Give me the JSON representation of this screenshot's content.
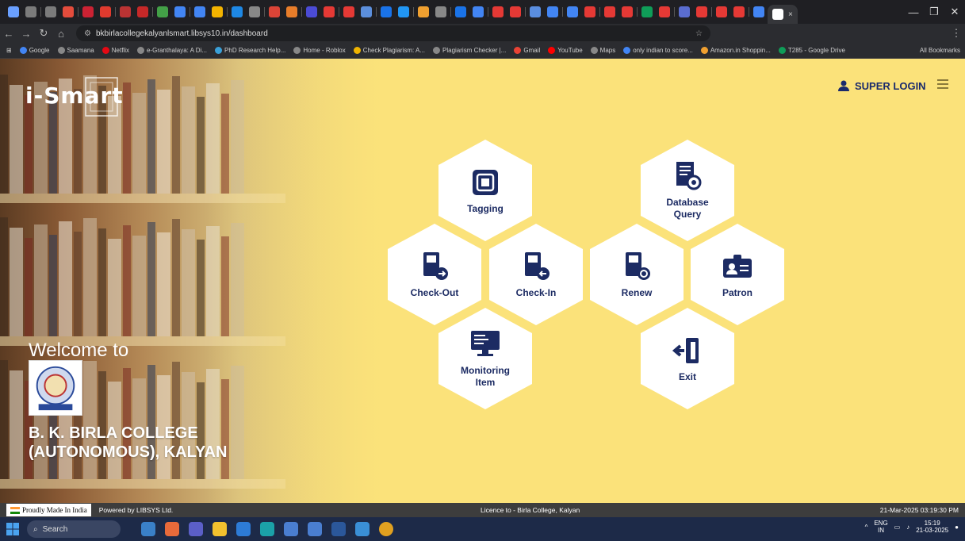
{
  "browser": {
    "url": "bkbirlacollegekalyanlsmart.libsys10.in/dashboard",
    "tab_colors": [
      "#6aa0ff",
      "#7b7b7b",
      "#7b7b7b",
      "#e44c3c",
      "#cc2233",
      "#e03a2e",
      "#b33",
      "#c62828",
      "#43a047",
      "#4285f4",
      "#4285f4",
      "#f4b400",
      "#1e88e5",
      "#888",
      "#db4437",
      "#e87d2a",
      "#4b4bd5",
      "#e53935",
      "#e53935",
      "#5c8fdc",
      "#1a73e8",
      "#2196f3",
      "#f0a030",
      "#888",
      "#1a73e8",
      "#4285f4",
      "#e53935",
      "#e53935",
      "#5a8ee0",
      "#4285f4",
      "#4285f4",
      "#e53935",
      "#e53935",
      "#e53935",
      "#0f9d58",
      "#e53935",
      "#5a6dd0",
      "#e53935",
      "#e53935",
      "#e53935",
      "#4285f4"
    ],
    "bookmarks": [
      {
        "label": "Google",
        "color": "#4285f4"
      },
      {
        "label": "Saamana",
        "color": "#888"
      },
      {
        "label": "Netflix",
        "color": "#e50914"
      },
      {
        "label": "e-Granthalaya: A Di...",
        "color": "#888"
      },
      {
        "label": "PhD Research Help...",
        "color": "#3aa0d8"
      },
      {
        "label": "Home - Roblox",
        "color": "#888"
      },
      {
        "label": "Check Plagiarism: A...",
        "color": "#f0b400"
      },
      {
        "label": "Plagiarism Checker |...",
        "color": "#888"
      },
      {
        "label": "Gmail",
        "color": "#ea4335"
      },
      {
        "label": "YouTube",
        "color": "#ff0000"
      },
      {
        "label": "Maps",
        "color": "#888"
      },
      {
        "label": "only indian to score...",
        "color": "#4285f4"
      },
      {
        "label": "Amazon.in Shoppin...",
        "color": "#f0a030"
      },
      {
        "label": "T285 - Google Drive",
        "color": "#0f9d58"
      }
    ],
    "all_bookmarks": "All Bookmarks"
  },
  "app": {
    "logo": "i-Smart",
    "welcome": "Welcome to",
    "college_line1": "B. K. BIRLA COLLEGE",
    "college_line2": "(AUTONOMOUS), KALYAN",
    "super_login": "SUPER LOGIN",
    "menu_items": [
      {
        "label": "Tagging",
        "icon": "tag-icon"
      },
      {
        "label": "Database Query",
        "icon": "database-query-icon"
      },
      {
        "label": "Check-Out",
        "icon": "checkout-icon"
      },
      {
        "label": "Check-In",
        "icon": "checkin-icon"
      },
      {
        "label": "Renew",
        "icon": "renew-icon"
      },
      {
        "label": "Patron",
        "icon": "patron-icon"
      },
      {
        "label": "Monitoring Item",
        "icon": "monitor-icon"
      },
      {
        "label": "Exit",
        "icon": "exit-icon"
      }
    ],
    "accent": "#1c2b63",
    "background": "#fbe27a"
  },
  "status_bar": {
    "made_in": "Proudly Made In India",
    "powered": "Powered by LIBSYS Ltd.",
    "licence": "Licence to - Birla College, Kalyan",
    "datetime": "21-Mar-2025 03:19:30 PM"
  },
  "taskbar": {
    "search": "Search",
    "lang1": "ENG",
    "lang2": "IN",
    "time": "15:19",
    "date": "21-03-2025"
  }
}
